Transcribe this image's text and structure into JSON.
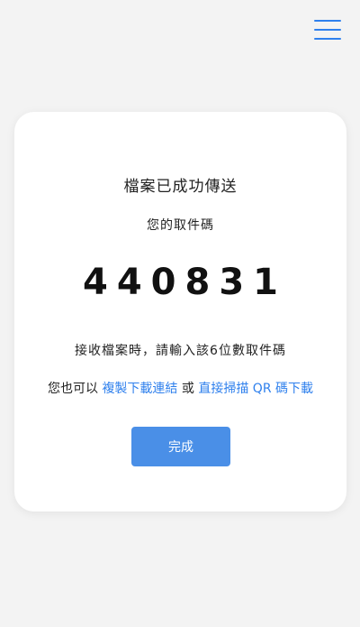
{
  "header": {
    "menu_icon": "hamburger-menu-icon",
    "accent_color": "#2f80ed"
  },
  "card": {
    "title": "檔案已成功傳送",
    "subtitle": "您的取件碼",
    "code": "440831",
    "instruction": "接收檔案時，請輸入該6位數取件碼",
    "alternatives": {
      "prefix": "您也可以",
      "copy_link": "複製下載連結",
      "or": "或",
      "scan_qr": "直接掃描 QR 碼下載"
    },
    "done_label": "完成"
  }
}
